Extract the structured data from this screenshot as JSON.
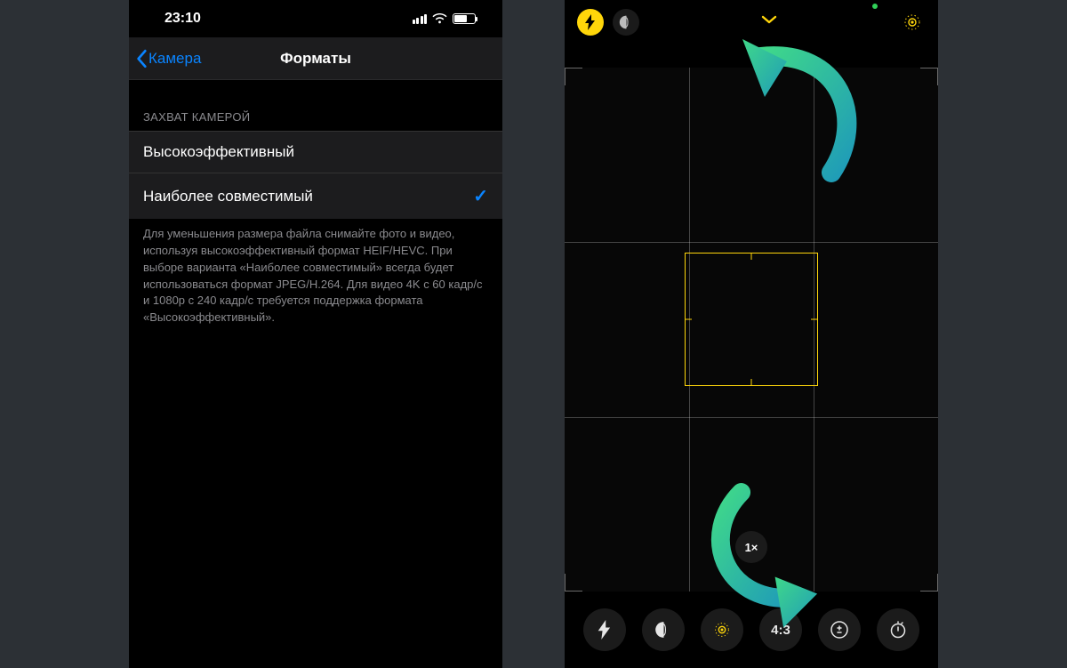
{
  "settings": {
    "status_time": "23:10",
    "back_label": "Камера",
    "title": "Форматы",
    "section_header": "ЗАХВАТ КАМЕРОЙ",
    "options": [
      {
        "label": "Высокоэффективный",
        "selected": false
      },
      {
        "label": "Наиболее совместимый",
        "selected": true
      }
    ],
    "footer": "Для уменьшения размера файла снимайте фото и видео, используя высокоэффективный формат HEIF/HEVC. При выборе варианта «Наиболее совместимый» всегда будет использоваться формат JPEG/H.264. Для видео 4K с 60 кадр/с и 1080p с 240 кадр/с требуется поддержка формата «Высокоэффективный».",
    "checkmark": "✓"
  },
  "camera": {
    "zoom_label": "1×",
    "aspect_label": "4:3"
  },
  "colors": {
    "accent_blue": "#0a84ff",
    "accent_yellow": "#ffd60a"
  }
}
